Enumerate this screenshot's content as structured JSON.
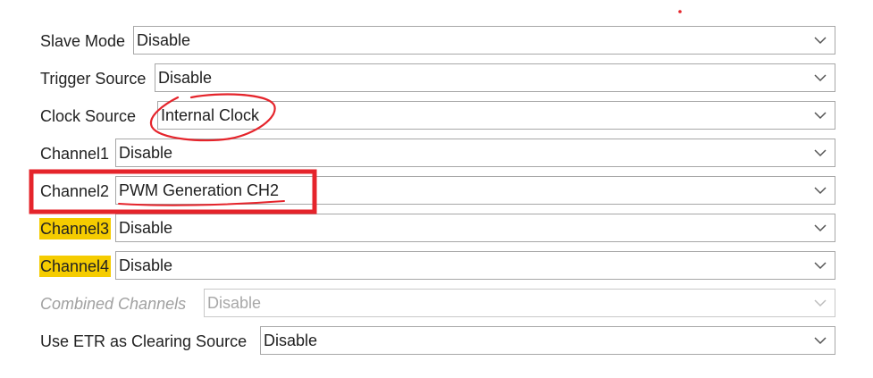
{
  "rows": [
    {
      "label": "Slave Mode",
      "value": "Disable"
    },
    {
      "label": "Trigger Source",
      "value": "Disable"
    },
    {
      "label": "Clock Source",
      "value": "Internal Clock"
    },
    {
      "label": "Channel1",
      "value": "Disable"
    },
    {
      "label": "Channel2",
      "value": "PWM Generation CH2"
    },
    {
      "label": "Channel3",
      "value": "Disable"
    },
    {
      "label": "Channel4",
      "value": "Disable"
    },
    {
      "label": "Combined Channels",
      "value": "Disable"
    },
    {
      "label": "Use ETR as Clearing Source",
      "value": "Disable"
    }
  ],
  "states": {
    "highlighted_labels": [
      "Channel3",
      "Channel4"
    ],
    "disabled_rows": [
      "Combined Channels"
    ],
    "boxed_row": "Channel2",
    "circled_value": "Internal Clock",
    "underlined_value": "PWM Generation CH2"
  },
  "icons": {
    "dropdown": "chevron-down-icon"
  },
  "colors": {
    "highlight": "#f5cc00",
    "annotation": "#e5242b",
    "border": "#a7a7a7",
    "disabled_text": "#a0a0a0"
  }
}
